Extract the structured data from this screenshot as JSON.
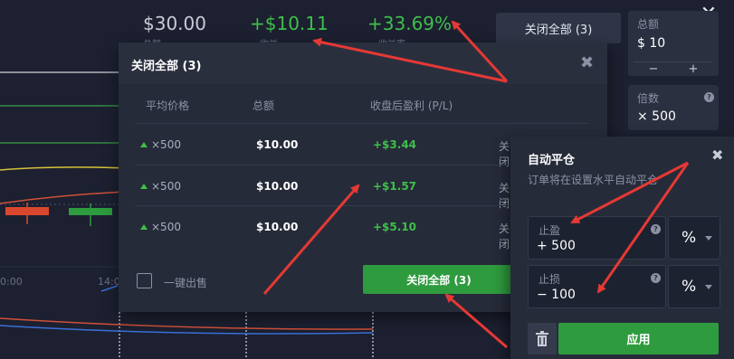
{
  "summary": {
    "total": "$30.00",
    "profit": "+$10.11",
    "profit_pct": "+33.69%",
    "total_label": "总额",
    "profit_label": "收益",
    "pct_label": "收益率"
  },
  "toolbar": {
    "close_all_label": "关闭全部 (3)"
  },
  "amount_field": {
    "label": "总额",
    "value": "$ 10",
    "minus": "−",
    "plus": "+"
  },
  "multiplier_field": {
    "label": "倍数",
    "value": "× 500"
  },
  "chart_axis": {
    "time_left": "0:00",
    "time_right": "14:0"
  },
  "modal": {
    "title": "关闭全部 (3)",
    "columns": {
      "avg_price": "平均价格",
      "amount": "总额",
      "pl": "收盘后盈利 (P/L)"
    },
    "rows": [
      {
        "multiplier": "×500",
        "amount": "$10.00",
        "pl": "+$3.44",
        "close": "关闭"
      },
      {
        "multiplier": "×500",
        "amount": "$10.00",
        "pl": "+$1.57",
        "close": "关闭"
      },
      {
        "multiplier": "×500",
        "amount": "$10.00",
        "pl": "+$5.10",
        "close": "关闭"
      }
    ],
    "one_click_label": "一键出售",
    "close_all_button": "关闭全部 (3)"
  },
  "auto_close": {
    "title": "自动平仓",
    "subtitle": "订单将在设置水平自动平仓",
    "take_profit": {
      "label": "止盈",
      "value": "+ 500",
      "unit": "%"
    },
    "stop_loss": {
      "label": "止损",
      "value": "− 100",
      "unit": "%"
    },
    "apply_button": "应用"
  },
  "colors": {
    "accent_green": "#2e9b3e",
    "profit_green": "#3fbf4b",
    "panel": "#262b39",
    "arrow_red": "#e53935"
  }
}
